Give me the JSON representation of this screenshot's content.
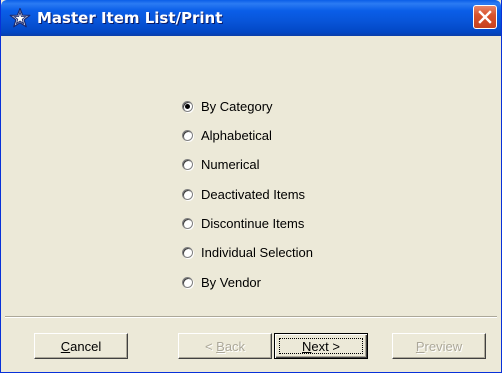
{
  "window": {
    "title": "Master Item List/Print",
    "app_icon": "star-icon",
    "close_icon": "close-icon"
  },
  "options": [
    {
      "label": "By Category",
      "checked": true
    },
    {
      "label": "Alphabetical",
      "checked": false
    },
    {
      "label": "Numerical",
      "checked": false
    },
    {
      "label": "Deactivated Items",
      "checked": false
    },
    {
      "label": "Discontinue Items",
      "checked": false
    },
    {
      "label": "Individual Selection",
      "checked": false
    },
    {
      "label": "By Vendor",
      "checked": false
    }
  ],
  "buttons": {
    "cancel": {
      "mnemonic": "C",
      "rest": "ancel",
      "enabled": true
    },
    "back": {
      "prefix": "< ",
      "mnemonic": "B",
      "rest": "ack",
      "enabled": false
    },
    "next": {
      "mnemonic": "N",
      "rest": "ext >",
      "enabled": true,
      "default": true
    },
    "preview": {
      "mnemonic": "P",
      "rest": "review",
      "enabled": false
    }
  },
  "colors": {
    "titlebar": "#0a5ee8",
    "face": "#ece9d8",
    "close": "#d9542e",
    "disabled_text": "#aca899"
  }
}
